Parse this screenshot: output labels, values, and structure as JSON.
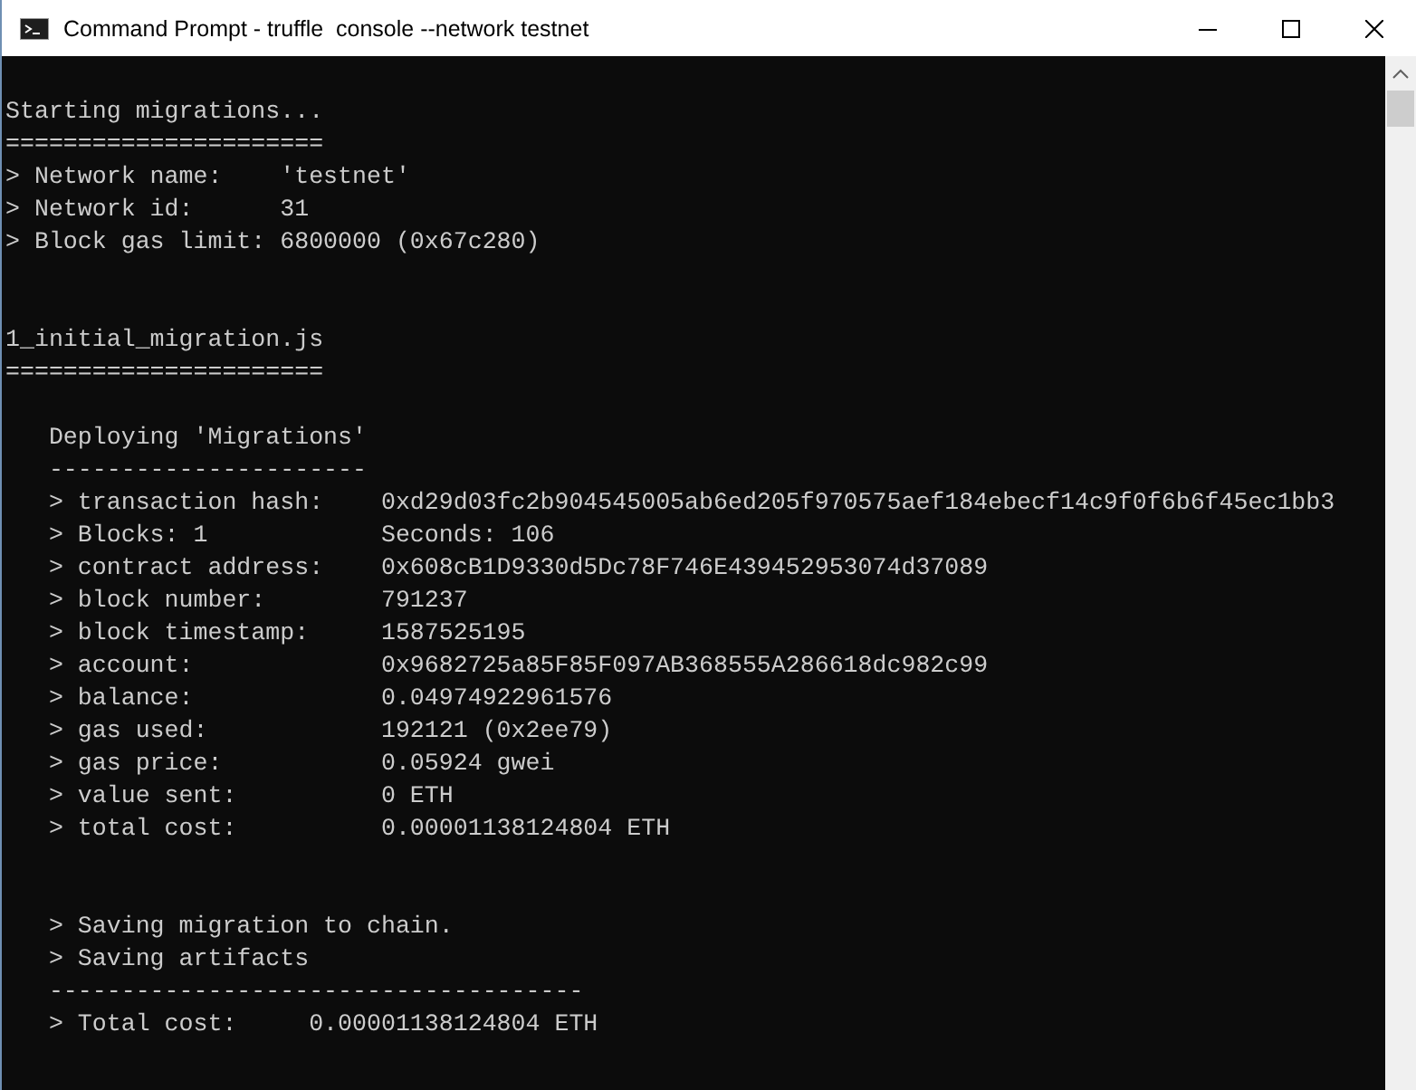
{
  "window": {
    "title": "Command Prompt - truffle  console --network testnet"
  },
  "console": {
    "lines": [
      {
        "kind": "blank"
      },
      {
        "kind": "text",
        "text": "Starting migrations..."
      },
      {
        "kind": "text",
        "text": "======================"
      },
      {
        "kind": "text",
        "text": "> Network name:    'testnet'"
      },
      {
        "kind": "text",
        "text": "> Network id:      31"
      },
      {
        "kind": "text",
        "text": "> Block gas limit: 6800000 (0x67c280)"
      },
      {
        "kind": "blank"
      },
      {
        "kind": "blank"
      },
      {
        "kind": "text",
        "text": "1_initial_migration.js"
      },
      {
        "kind": "text",
        "text": "======================"
      },
      {
        "kind": "blank"
      },
      {
        "kind": "text",
        "text": "   Deploying 'Migrations'"
      },
      {
        "kind": "text",
        "text": "   ----------------------"
      },
      {
        "kind": "text",
        "text": "   > transaction hash:    0xd29d03fc2b904545005ab6ed205f970575aef184ebecf14c9f0f6b6f45ec1bb3"
      },
      {
        "kind": "text",
        "text": "   > Blocks: 1            Seconds: 106"
      },
      {
        "kind": "text",
        "text": "   > contract address:    0x608cB1D9330d5Dc78F746E439452953074d37089"
      },
      {
        "kind": "text",
        "text": "   > block number:        791237"
      },
      {
        "kind": "text",
        "text": "   > block timestamp:     1587525195"
      },
      {
        "kind": "text",
        "text": "   > account:             0x9682725a85F85F097AB368555A286618dc982c99"
      },
      {
        "kind": "text",
        "text": "   > balance:             0.04974922961576"
      },
      {
        "kind": "text",
        "text": "   > gas used:            192121 (0x2ee79)"
      },
      {
        "kind": "text",
        "text": "   > gas price:           0.05924 gwei"
      },
      {
        "kind": "text",
        "text": "   > value sent:          0 ETH"
      },
      {
        "kind": "text",
        "text": "   > total cost:          0.00001138124804 ETH"
      },
      {
        "kind": "blank"
      },
      {
        "kind": "blank"
      },
      {
        "kind": "text",
        "text": "   > Saving migration to chain."
      },
      {
        "kind": "text",
        "text": "   > Saving artifacts"
      },
      {
        "kind": "text",
        "text": "   -------------------------------------"
      },
      {
        "kind": "text",
        "text": "   > Total cost:     0.00001138124804 ETH"
      }
    ]
  }
}
